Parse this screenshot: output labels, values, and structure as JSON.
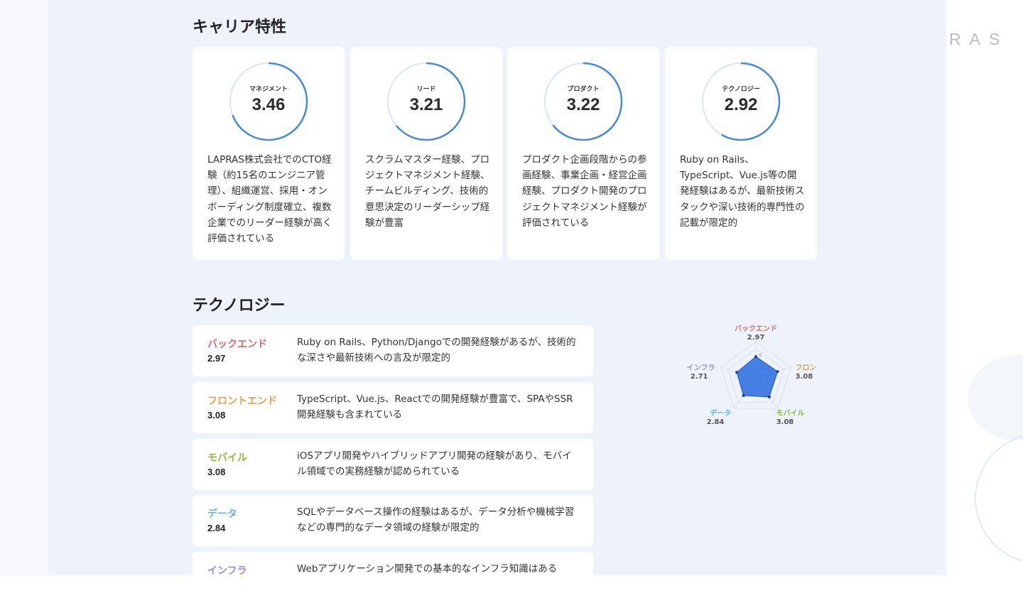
{
  "colors": {
    "panel_bg": "#eef2fb",
    "ring_accent": "#4a8ad8",
    "ring_track": "#d8e6f5",
    "backend": "#e06a6a",
    "frontend": "#eaa04a",
    "mobile": "#8dbb3c",
    "data": "#6ab7e6",
    "infra": "#9c8adb",
    "radar_fill": "#2f6fe0"
  },
  "background": {
    "logo_fragment": "RAS"
  },
  "career": {
    "title": "キャリア特性",
    "cards": [
      {
        "label": "マネジメント",
        "score": "3.46",
        "value": 3.46,
        "description": "LAPRAS株式会社でのCTO経験（約15名のエンジニア管理）、組織運営、採用・オンボーディング制度確立、複数企業でのリーダー経験が高く評価されている"
      },
      {
        "label": "リード",
        "score": "3.21",
        "value": 3.21,
        "description": "スクラムマスター経験、プロジェクトマネジメント経験、チームビルディング、技術的意思決定のリーダーシップ経験が豊富"
      },
      {
        "label": "プロダクト",
        "score": "3.22",
        "value": 3.22,
        "description": "プロダクト企画段階からの参画経験、事業企画・経営企画経験、プロダクト開発のプロジェクトマネジメント経験が評価されている"
      },
      {
        "label": "テクノロジー",
        "score": "2.92",
        "value": 2.92,
        "description": "Ruby on Rails、TypeScript、Vue.js等の開発経験はあるが、最新技術スタックや深い技術的専門性の記載が限定的"
      }
    ]
  },
  "technology": {
    "title": "テクノロジー",
    "items": [
      {
        "name": "バックエンド",
        "score": "2.97",
        "color": "#e06a6a",
        "description": "Ruby on Rails、Python/Djangoでの開発経験があるが、技術的な深さや最新技術への言及が限定的"
      },
      {
        "name": "フロントエンド",
        "score": "3.08",
        "color": "#eaa04a",
        "description": "TypeScript、Vue.js、Reactでの開発経験が豊富で、SPAやSSR開発経験も含まれている"
      },
      {
        "name": "モバイル",
        "score": "3.08",
        "color": "#8dbb3c",
        "description": "iOSアプリ開発やハイブリッドアプリ開発の経験があり、モバイル領域での実務経験が認められている"
      },
      {
        "name": "データ",
        "score": "2.84",
        "color": "#6ab7e6",
        "description": "SQLやデータベース操作の経験はあるが、データ分析や機械学習などの専門的なデータ領域の経験が限定的"
      },
      {
        "name": "インフラ",
        "score": "",
        "color": "#9c8adb",
        "description": "Webアプリケーション開発での基本的なインフラ知識はある"
      }
    ],
    "radar": {
      "max_label": "5",
      "max": 5,
      "axes": [
        {
          "name": "バックエンド",
          "score": "2.97",
          "value": 2.97,
          "color": "#e06a6a"
        },
        {
          "name": "フロントエンド",
          "score": "3.08",
          "value": 3.08,
          "color": "#eaa04a"
        },
        {
          "name": "モバイル",
          "score": "3.08",
          "value": 3.08,
          "color": "#8dbb3c"
        },
        {
          "name": "データ",
          "score": "2.84",
          "value": 2.84,
          "color": "#6ab7e6"
        },
        {
          "name": "インフラ",
          "score": "2.71",
          "value": 2.71,
          "color": "#9c8adb"
        }
      ]
    }
  }
}
